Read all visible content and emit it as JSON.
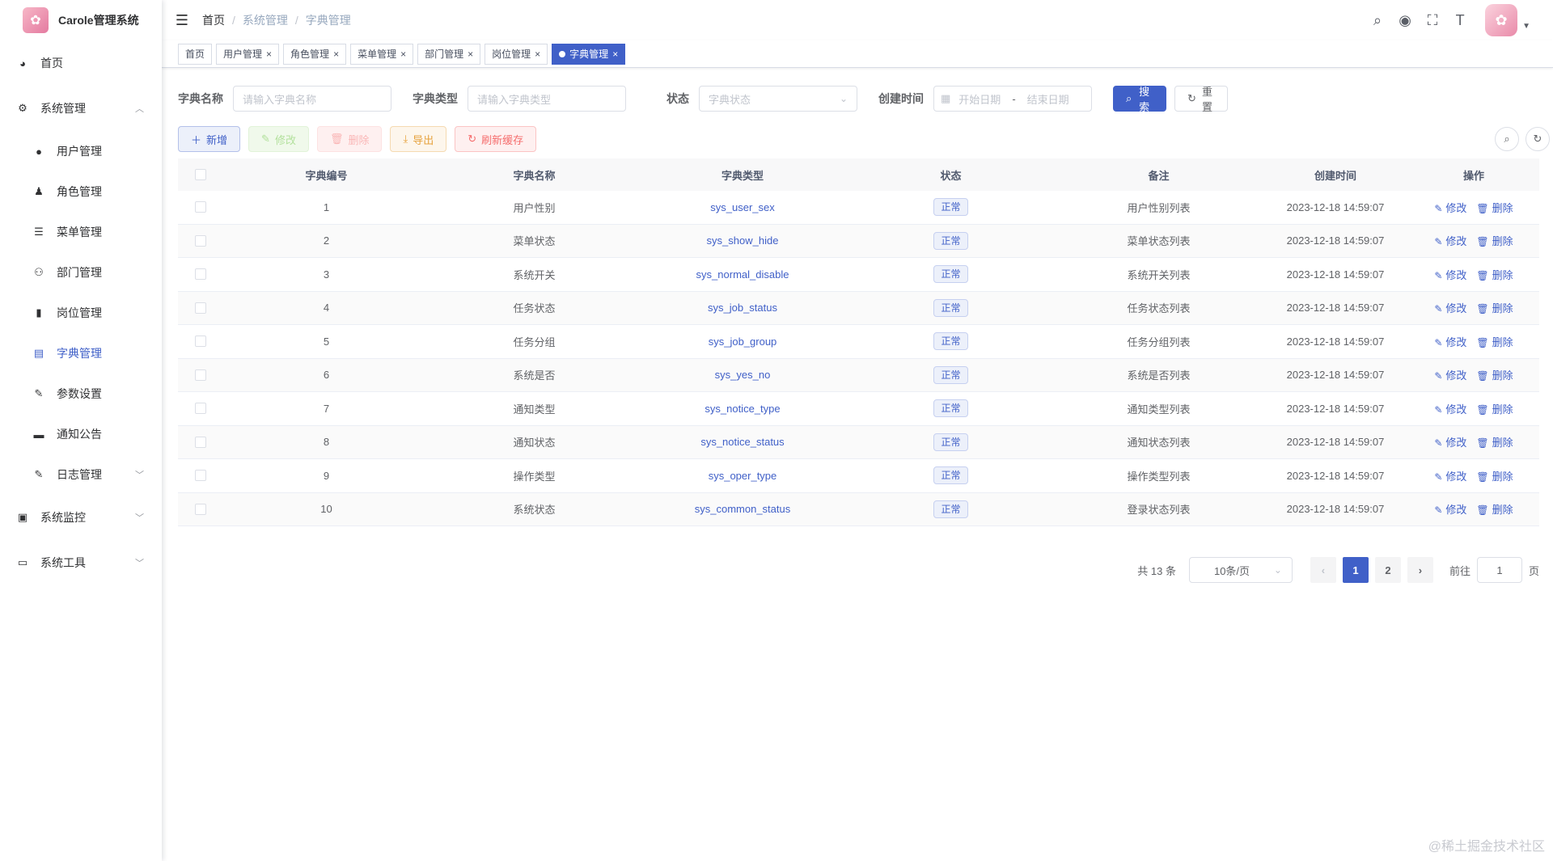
{
  "app": {
    "title": "Carole管理系统"
  },
  "sidebar": {
    "items": [
      {
        "label": "首页",
        "icon": "dashboard-icon",
        "glyph": "◕",
        "level": "top"
      },
      {
        "label": "系统管理",
        "icon": "system-icon",
        "glyph": "⚙",
        "level": "top",
        "expanded": true
      },
      {
        "label": "用户管理",
        "icon": "user-icon",
        "glyph": "●",
        "level": "sub"
      },
      {
        "label": "角色管理",
        "icon": "peoples-icon",
        "glyph": "♟",
        "level": "sub"
      },
      {
        "label": "菜单管理",
        "icon": "tree-table-icon",
        "glyph": "☰",
        "level": "sub"
      },
      {
        "label": "部门管理",
        "icon": "tree-icon",
        "glyph": "⚇",
        "level": "sub"
      },
      {
        "label": "岗位管理",
        "icon": "post-icon",
        "glyph": "▮",
        "level": "sub"
      },
      {
        "label": "字典管理",
        "icon": "dict-icon",
        "glyph": "▤",
        "level": "sub",
        "active": true
      },
      {
        "label": "参数设置",
        "icon": "edit-icon",
        "glyph": "✎",
        "level": "sub"
      },
      {
        "label": "通知公告",
        "icon": "message-icon",
        "glyph": "▬",
        "level": "sub"
      },
      {
        "label": "日志管理",
        "icon": "log-icon",
        "glyph": "✎",
        "level": "sub",
        "collapsed": true
      },
      {
        "label": "系统监控",
        "icon": "monitor-icon",
        "glyph": "▣",
        "level": "top",
        "collapsed": true
      },
      {
        "label": "系统工具",
        "icon": "tool-icon",
        "glyph": "▭",
        "level": "top",
        "collapsed": true
      }
    ]
  },
  "header": {
    "breadcrumb": [
      "首页",
      "系统管理",
      "字典管理"
    ]
  },
  "tags": [
    {
      "label": "首页",
      "closable": false,
      "active": false
    },
    {
      "label": "用户管理",
      "closable": true,
      "active": false
    },
    {
      "label": "角色管理",
      "closable": true,
      "active": false
    },
    {
      "label": "菜单管理",
      "closable": true,
      "active": false
    },
    {
      "label": "部门管理",
      "closable": true,
      "active": false
    },
    {
      "label": "岗位管理",
      "closable": true,
      "active": false
    },
    {
      "label": "字典管理",
      "closable": true,
      "active": true
    }
  ],
  "search": {
    "dict_name_label": "字典名称",
    "dict_name_placeholder": "请输入字典名称",
    "dict_type_label": "字典类型",
    "dict_type_placeholder": "请输入字典类型",
    "status_label": "状态",
    "status_placeholder": "字典状态",
    "created_label": "创建时间",
    "start_placeholder": "开始日期",
    "range_sep": "-",
    "end_placeholder": "结束日期",
    "search_btn": "搜索",
    "reset_btn": "重置"
  },
  "toolbar": {
    "add": "新增",
    "edit": "修改",
    "delete": "删除",
    "export": "导出",
    "refresh_cache": "刷新缓存"
  },
  "table": {
    "columns": [
      "字典编号",
      "字典名称",
      "字典类型",
      "状态",
      "备注",
      "创建时间",
      "操作"
    ],
    "edit_label": "修改",
    "delete_label": "删除",
    "rows": [
      {
        "id": "1",
        "name": "用户性别",
        "type": "sys_user_sex",
        "status": "正常",
        "remark": "用户性别列表",
        "time": "2023-12-18 14:59:07"
      },
      {
        "id": "2",
        "name": "菜单状态",
        "type": "sys_show_hide",
        "status": "正常",
        "remark": "菜单状态列表",
        "time": "2023-12-18 14:59:07"
      },
      {
        "id": "3",
        "name": "系统开关",
        "type": "sys_normal_disable",
        "status": "正常",
        "remark": "系统开关列表",
        "time": "2023-12-18 14:59:07"
      },
      {
        "id": "4",
        "name": "任务状态",
        "type": "sys_job_status",
        "status": "正常",
        "remark": "任务状态列表",
        "time": "2023-12-18 14:59:07"
      },
      {
        "id": "5",
        "name": "任务分组",
        "type": "sys_job_group",
        "status": "正常",
        "remark": "任务分组列表",
        "time": "2023-12-18 14:59:07"
      },
      {
        "id": "6",
        "name": "系统是否",
        "type": "sys_yes_no",
        "status": "正常",
        "remark": "系统是否列表",
        "time": "2023-12-18 14:59:07"
      },
      {
        "id": "7",
        "name": "通知类型",
        "type": "sys_notice_type",
        "status": "正常",
        "remark": "通知类型列表",
        "time": "2023-12-18 14:59:07"
      },
      {
        "id": "8",
        "name": "通知状态",
        "type": "sys_notice_status",
        "status": "正常",
        "remark": "通知状态列表",
        "time": "2023-12-18 14:59:07"
      },
      {
        "id": "9",
        "name": "操作类型",
        "type": "sys_oper_type",
        "status": "正常",
        "remark": "操作类型列表",
        "time": "2023-12-18 14:59:07"
      },
      {
        "id": "10",
        "name": "系统状态",
        "type": "sys_common_status",
        "status": "正常",
        "remark": "登录状态列表",
        "time": "2023-12-18 14:59:07"
      }
    ]
  },
  "pagination": {
    "total_text": "共 13 条",
    "page_size": "10条/页",
    "pages": [
      "1",
      "2"
    ],
    "current_page": "1",
    "goto_label": "前往",
    "goto_value": "1",
    "page_unit": "页"
  },
  "watermark": "@稀土掘金技术社区",
  "colors": {
    "primary": "#4060c8",
    "border": "#dcdfe6",
    "text": "#606266"
  }
}
